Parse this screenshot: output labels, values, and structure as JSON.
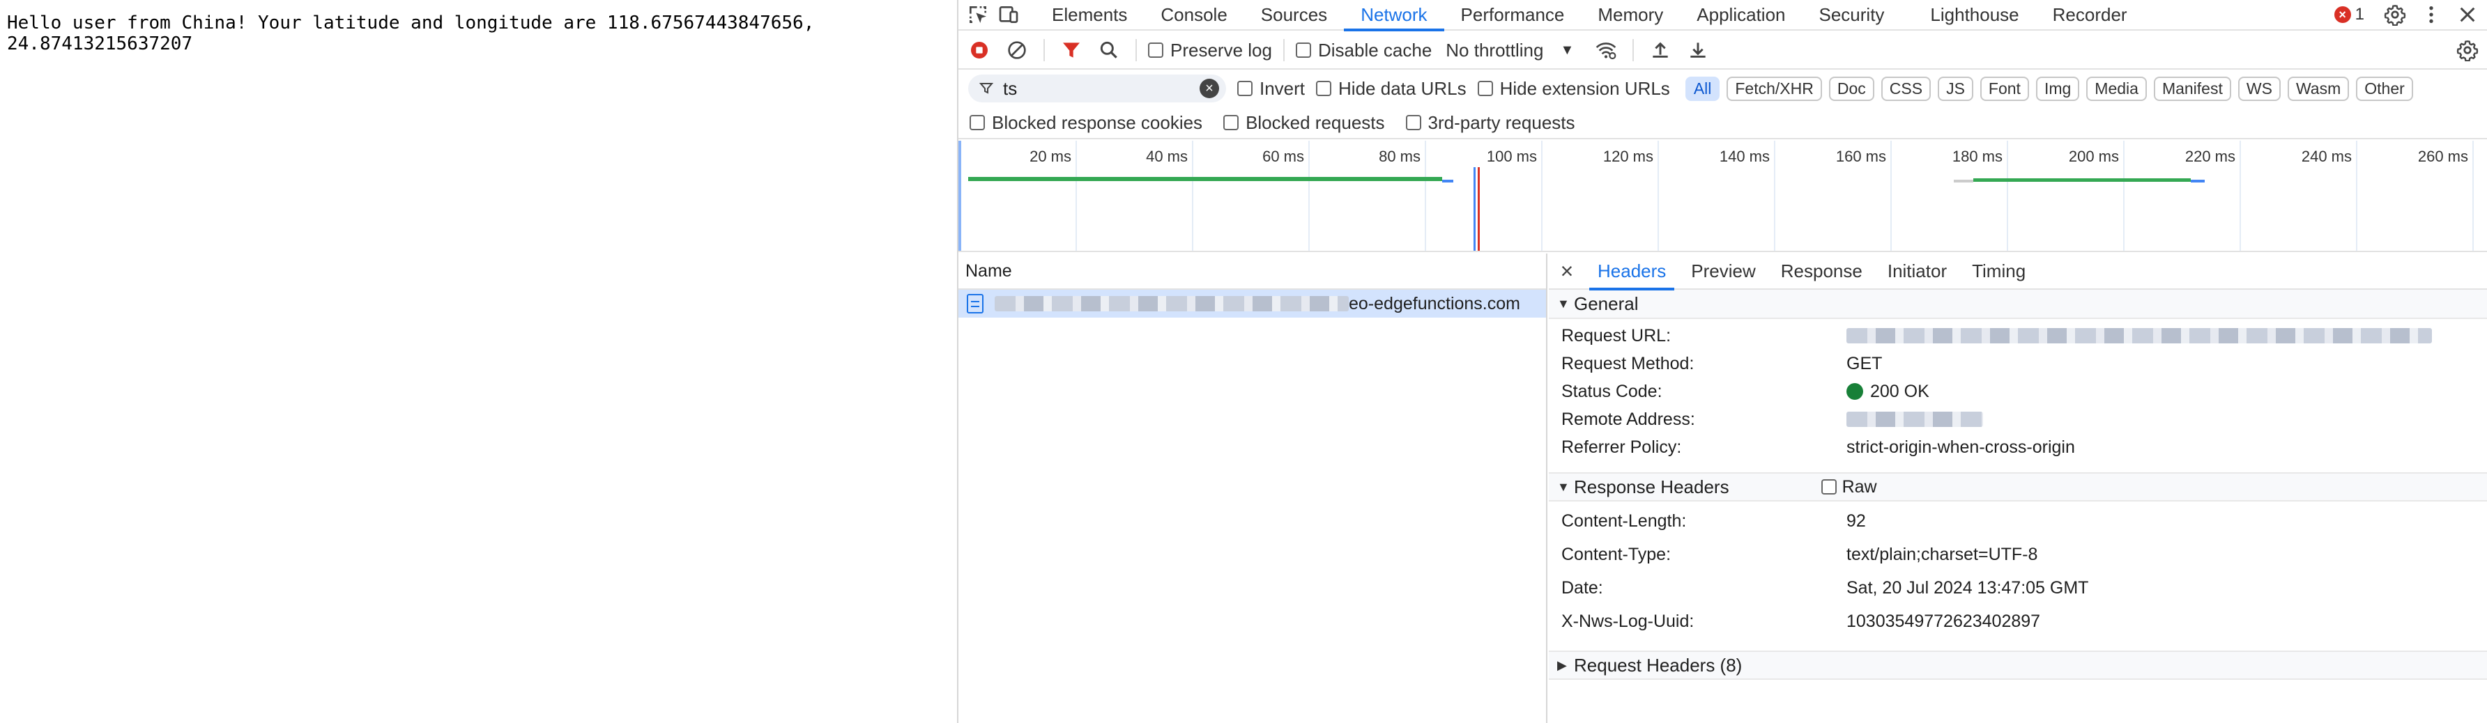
{
  "page": {
    "text": "Hello user from China! Your latitude and longitude are 118.67567443847656,\n24.87413215637207"
  },
  "devtools": {
    "tabs": [
      {
        "label": "Elements",
        "active": false
      },
      {
        "label": "Console",
        "active": false
      },
      {
        "label": "Sources",
        "active": false
      },
      {
        "label": "Network",
        "active": true
      },
      {
        "label": "Performance",
        "active": false
      },
      {
        "label": "Memory",
        "active": false
      },
      {
        "label": "Application",
        "active": false
      },
      {
        "label": "Security",
        "active": false
      },
      {
        "label": "Lighthouse",
        "active": false
      },
      {
        "label": "Recorder",
        "active": false
      }
    ],
    "error_count": "1",
    "toolbar": {
      "preserve_log": "Preserve log",
      "disable_cache": "Disable cache",
      "throttling": "No throttling"
    },
    "filter": {
      "value": "ts",
      "invert": "Invert",
      "hide_data_urls": "Hide data URLs",
      "hide_extension_urls": "Hide extension URLs",
      "types": [
        "All",
        "Fetch/XHR",
        "Doc",
        "CSS",
        "JS",
        "Font",
        "Img",
        "Media",
        "Manifest",
        "WS",
        "Wasm",
        "Other"
      ],
      "active_type": "All",
      "blocked_response_cookies": "Blocked response cookies",
      "blocked_requests": "Blocked requests",
      "third_party_requests": "3rd-party requests"
    },
    "timeline": {
      "ticks": [
        "20 ms",
        "40 ms",
        "60 ms",
        "80 ms",
        "100 ms",
        "120 ms",
        "140 ms",
        "160 ms",
        "180 ms",
        "200 ms",
        "220 ms",
        "240 ms",
        "260 ms"
      ]
    },
    "requests": {
      "column": "Name",
      "rows": [
        {
          "name_suffix": "eo-edgefunctions.com"
        }
      ]
    },
    "details": {
      "tabs": [
        {
          "label": "Headers",
          "active": true
        },
        {
          "label": "Preview",
          "active": false
        },
        {
          "label": "Response",
          "active": false
        },
        {
          "label": "Initiator",
          "active": false
        },
        {
          "label": "Timing",
          "active": false
        }
      ],
      "general": {
        "title": "General",
        "rows": [
          {
            "key": "Request URL:",
            "value": ""
          },
          {
            "key": "Request Method:",
            "value": "GET"
          },
          {
            "key": "Status Code:",
            "value": "200 OK"
          },
          {
            "key": "Remote Address:",
            "value": ""
          },
          {
            "key": "Referrer Policy:",
            "value": "strict-origin-when-cross-origin"
          }
        ]
      },
      "response_headers": {
        "title": "Response Headers",
        "raw_label": "Raw",
        "rows": [
          {
            "key": "Content-Length:",
            "value": "92"
          },
          {
            "key": "Content-Type:",
            "value": "text/plain;charset=UTF-8"
          },
          {
            "key": "Date:",
            "value": "Sat, 20 Jul 2024 13:47:05 GMT"
          },
          {
            "key": "X-Nws-Log-Uuid:",
            "value": "10303549772623402897"
          }
        ]
      },
      "request_headers": {
        "title": "Request Headers (8)"
      }
    },
    "colors": {
      "accent": "#1a73e8",
      "selected_row": "#d3e3fd",
      "status_ok": "#188038",
      "error": "#d93025"
    }
  }
}
